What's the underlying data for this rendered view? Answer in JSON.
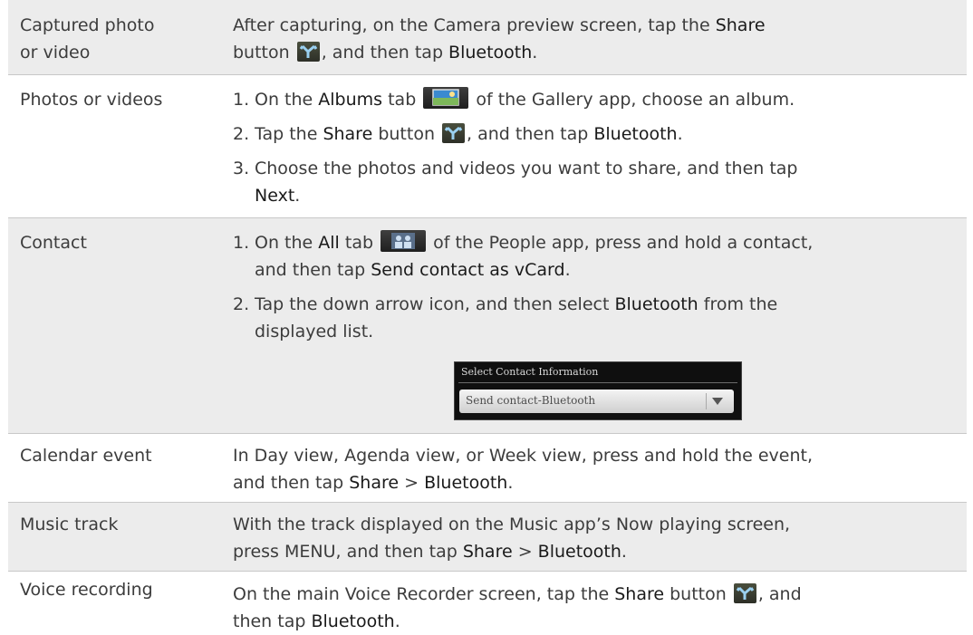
{
  "rows": [
    {
      "label": [
        "Captured photo",
        "or video"
      ],
      "desc": {
        "a": "After capturing, on the Camera preview screen, tap the ",
        "b": "Share",
        "c": "button ",
        "d": ", and then tap ",
        "e": "Bluetooth",
        "f": "."
      }
    },
    {
      "label": [
        "Photos or videos"
      ],
      "steps": [
        {
          "num": "1.",
          "a": "On the ",
          "b": "Albums",
          "c": " tab ",
          "d": " of the Gallery app, choose an album."
        },
        {
          "num": "2.",
          "a": "Tap the ",
          "b": "Share",
          "c": " button ",
          "d": ", and then tap ",
          "e": "Bluetooth",
          "f": "."
        },
        {
          "num": "3.",
          "a": "Choose the photos and videos you want to share, and then tap",
          "b": "Next",
          "c": "."
        }
      ]
    },
    {
      "label": [
        "Contact"
      ],
      "steps": [
        {
          "num": "1.",
          "a": "On the ",
          "b": "All",
          "c": " tab ",
          "d": " of the People app, press and hold a contact,",
          "e": "and then tap ",
          "f": "Send contact as vCard",
          "g": "."
        },
        {
          "num": "2.",
          "a": "Tap the down arrow icon, and then select ",
          "b": "Bluetooth",
          "c": " from the",
          "d": "displayed list."
        }
      ],
      "screenshot": {
        "title": "Select Contact Information",
        "field": "Send contact-Bluetooth"
      }
    },
    {
      "label": [
        "Calendar event"
      ],
      "desc": {
        "a": "In Day view, Agenda view, or Week view, press and hold the event,",
        "b": "and then tap ",
        "c": "Share",
        "d": " > ",
        "e": "Bluetooth",
        "f": "."
      }
    },
    {
      "label": [
        "Music track"
      ],
      "desc": {
        "a": "With the track displayed on the Music app’s Now playing screen,",
        "b": "press MENU, and then tap ",
        "c": "Share",
        "d": " > ",
        "e": "Bluetooth",
        "f": "."
      }
    },
    {
      "label": [
        "Voice recording"
      ],
      "desc": {
        "a": "On the main Voice Recorder screen, tap the ",
        "b": "Share",
        "c": " button ",
        "d": ", and",
        "e": "then tap ",
        "f": "Bluetooth",
        "g": "."
      }
    }
  ],
  "icons": {
    "share": "share-icon",
    "albums": "albums-tab-icon",
    "all": "all-tab-icon",
    "dropdown": "dropdown-arrow-icon"
  },
  "colors": {
    "row_shade": "#ececec",
    "rule": "#c8c8c8",
    "text": "#3c3c3c"
  }
}
